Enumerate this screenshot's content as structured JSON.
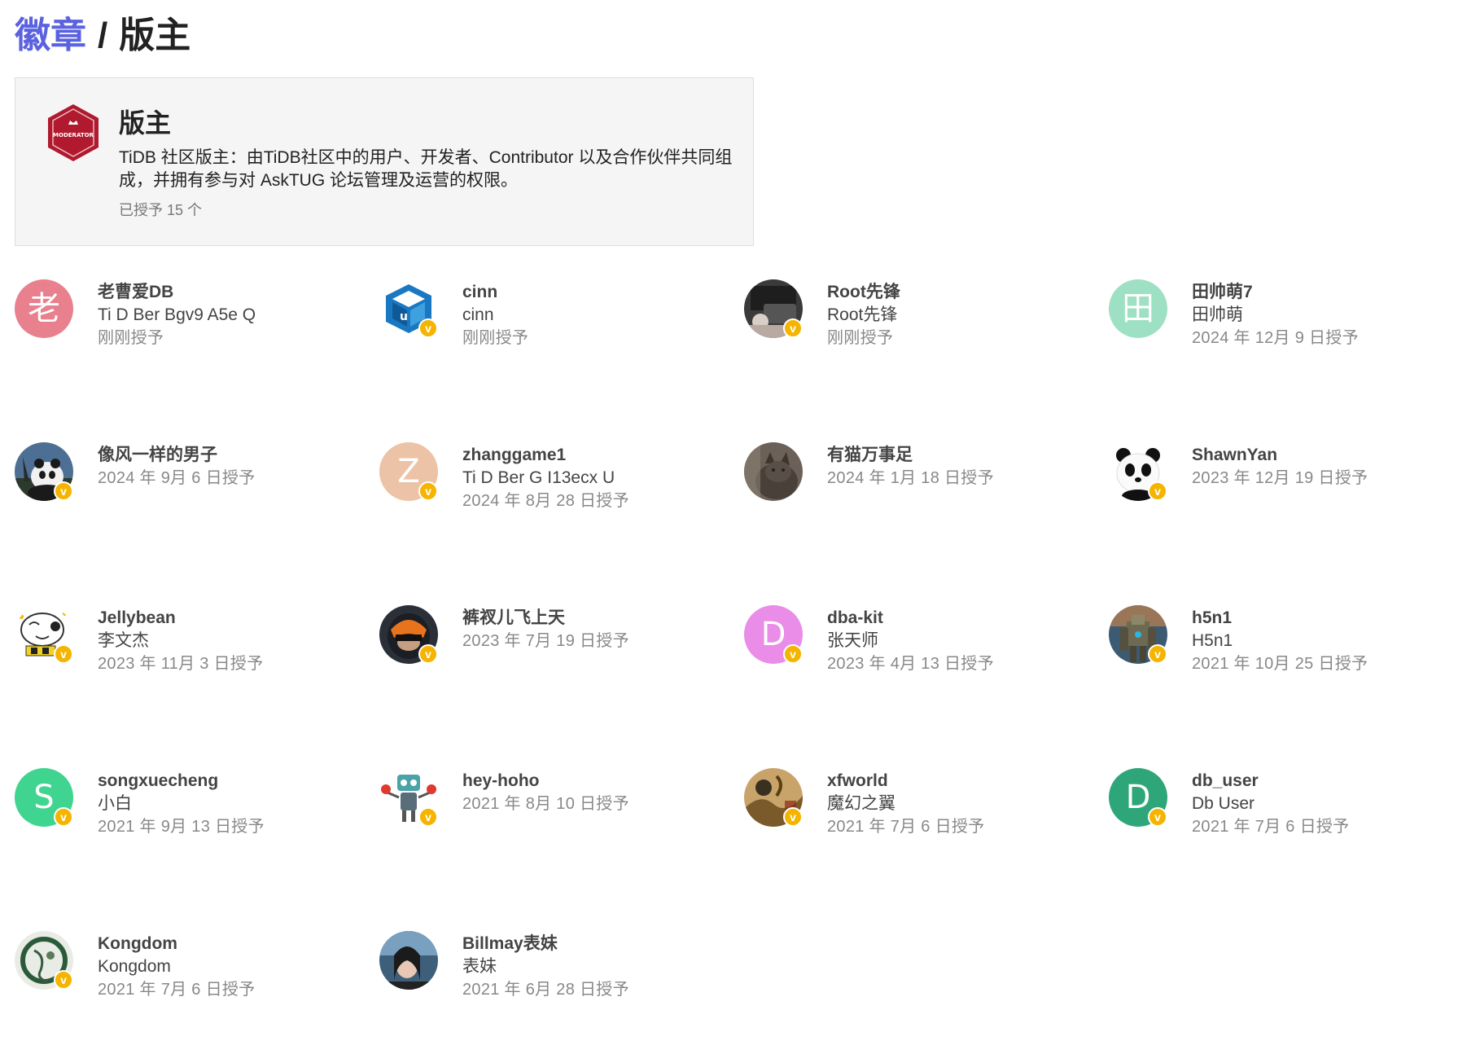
{
  "breadcrumb": {
    "parent": "徽章",
    "separator": "/",
    "current": "版主"
  },
  "badge": {
    "title": "版主",
    "description": "TiDB 社区版主：由TiDB社区中的用户、开发者、Contributor 以及合作伙伴共同组成，并拥有参与对 AskTUG 论坛管理及运营的权限。",
    "granted_count": "已授予 15 个",
    "icon_text": "MODERATOR",
    "icon_color": "#b0192e"
  },
  "verified_mark": "v",
  "users": [
    {
      "username": "老曹爱DB",
      "name": "Ti D Ber Bgv9 A5e Q",
      "granted": "刚刚授予",
      "avatar_letter": "老",
      "avatar_color": "#e8808e",
      "verified": false
    },
    {
      "username": "cinn",
      "name": "cinn",
      "granted": "刚刚授予",
      "avatar_icon": "cube-logo-icon",
      "verified": true
    },
    {
      "username": "Root先锋",
      "name": "Root先锋",
      "granted": "刚刚授予",
      "avatar_icon": "laptop-photo-icon",
      "verified": true
    },
    {
      "username": "田帅萌7",
      "name": "田帅萌",
      "granted": "2024 年 12月 9 日授予",
      "avatar_letter": "田",
      "avatar_color": "#9ee0c3",
      "verified": false
    },
    {
      "username": "像风一样的男子",
      "name": "",
      "granted": "2024 年 9月 6 日授予",
      "avatar_icon": "panda-photo-icon",
      "verified": true
    },
    {
      "username": "zhanggame1",
      "name": "Ti D Ber G I13ecx U",
      "granted": "2024 年 8月 28 日授予",
      "avatar_letter": "Z",
      "avatar_color": "#ecc3a6",
      "verified": true
    },
    {
      "username": "有猫万事足",
      "name": "",
      "granted": "2024 年 1月 18 日授予",
      "avatar_icon": "cat-photo-icon",
      "verified": false
    },
    {
      "username": "ShawnYan",
      "name": "",
      "granted": "2023 年 12月 19 日授予",
      "avatar_icon": "panda-cartoon-icon",
      "verified": true
    },
    {
      "username": "Jellybean",
      "name": "李文杰",
      "granted": "2023 年 11月 3 日授予",
      "avatar_icon": "cartoon-cow-icon",
      "verified": true
    },
    {
      "username": "裤衩儿飞上天",
      "name": "",
      "granted": "2023 年 7月 19 日授予",
      "avatar_icon": "helmet-photo-icon",
      "verified": true
    },
    {
      "username": "dba-kit",
      "name": "张天师",
      "granted": "2023 年 4月 13 日授予",
      "avatar_letter": "D",
      "avatar_color": "#e98de8",
      "verified": true
    },
    {
      "username": "h5n1",
      "name": "H5n1",
      "granted": "2021 年 10月 25 日授予",
      "avatar_icon": "robot-warrior-icon",
      "verified": true
    },
    {
      "username": "songxuecheng",
      "name": "小白",
      "granted": "2021 年 9月 13 日授予",
      "avatar_letter": "S",
      "avatar_color": "#3fd48f",
      "verified": true
    },
    {
      "username": "hey-hoho",
      "name": "",
      "granted": "2021 年 8月 10 日授予",
      "avatar_icon": "robot-cartoon-icon",
      "verified": true
    },
    {
      "username": "xfworld",
      "name": "魔幻之翼",
      "granted": "2021 年 7月 6 日授予",
      "avatar_icon": "painting-photo-icon",
      "verified": true
    },
    {
      "username": "db_user",
      "name": "Db User",
      "granted": "2021 年 7月 6 日授予",
      "avatar_letter": "D",
      "avatar_color": "#2fa679",
      "verified": true
    },
    {
      "username": "Kongdom",
      "name": "Kongdom",
      "granted": "2021 年 7月 6 日授予",
      "avatar_icon": "ink-painting-icon",
      "verified": true
    },
    {
      "username": "Billmay表妹",
      "name": "表妹",
      "granted": "2021 年 6月 28 日授予",
      "avatar_icon": "portrait-photo-icon",
      "verified": false
    }
  ]
}
